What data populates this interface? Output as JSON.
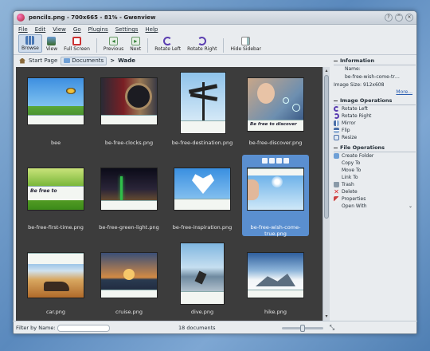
{
  "window": {
    "title": "pencils.png - 700x665 - 81% - Gwenview",
    "buttons": [
      "?",
      "^",
      "×"
    ]
  },
  "menubar": [
    "File",
    "Edit",
    "View",
    "Go",
    "Plugins",
    "Settings",
    "Help"
  ],
  "toolbar": {
    "browse": "Browse",
    "view": "View",
    "full_screen": "Full Screen",
    "previous": "Previous",
    "next": "Next",
    "rotate_left": "Rotate Left",
    "rotate_right": "Rotate Right",
    "hide_sidebar": "Hide Sidebar"
  },
  "breadcrumb": {
    "start": "Start Page",
    "folder": "Documents",
    "sep": ">",
    "current": "Wade"
  },
  "tiles": [
    {
      "caption": "bee"
    },
    {
      "caption": "be-free-clocks.png"
    },
    {
      "caption": "be-free-destination.png"
    },
    {
      "caption": "be-free-discover.png"
    },
    {
      "caption": "be-free-first-time.png"
    },
    {
      "caption": "be-free-green-light.png"
    },
    {
      "caption": "be-free-inspiration.png"
    },
    {
      "caption": "be-free-wish-come-true.png"
    },
    {
      "caption": "car.png"
    },
    {
      "caption": "cruise.png"
    },
    {
      "caption": "dive.png"
    },
    {
      "caption": "hike.png"
    }
  ],
  "thumb_text": {
    "be_free_to": "Be free to",
    "be_free_to_discover": "Be free to discover"
  },
  "sidebar": {
    "information": {
      "title": "Information",
      "name_label": "Name:",
      "name_value": "be-free-wish-come-true...",
      "size_label": "Image Size:",
      "size_value": "912x608",
      "more": "More..."
    },
    "image_operations": {
      "title": "Image Operations",
      "items": [
        "Rotate Left",
        "Rotate Right",
        "Mirror",
        "Flip",
        "Resize"
      ]
    },
    "file_operations": {
      "title": "File Operations",
      "items": [
        "Create Folder",
        "Copy To",
        "Move To",
        "Link To",
        "Trash",
        "Delete",
        "Properties",
        "Open With"
      ]
    }
  },
  "status": {
    "filter_label": "Filter by Name:",
    "doc_count": "18 documents",
    "zoom_level": 0.5
  },
  "colors": {
    "accent": "#5a8fd0",
    "grid_bg": "#3c3c3c"
  }
}
